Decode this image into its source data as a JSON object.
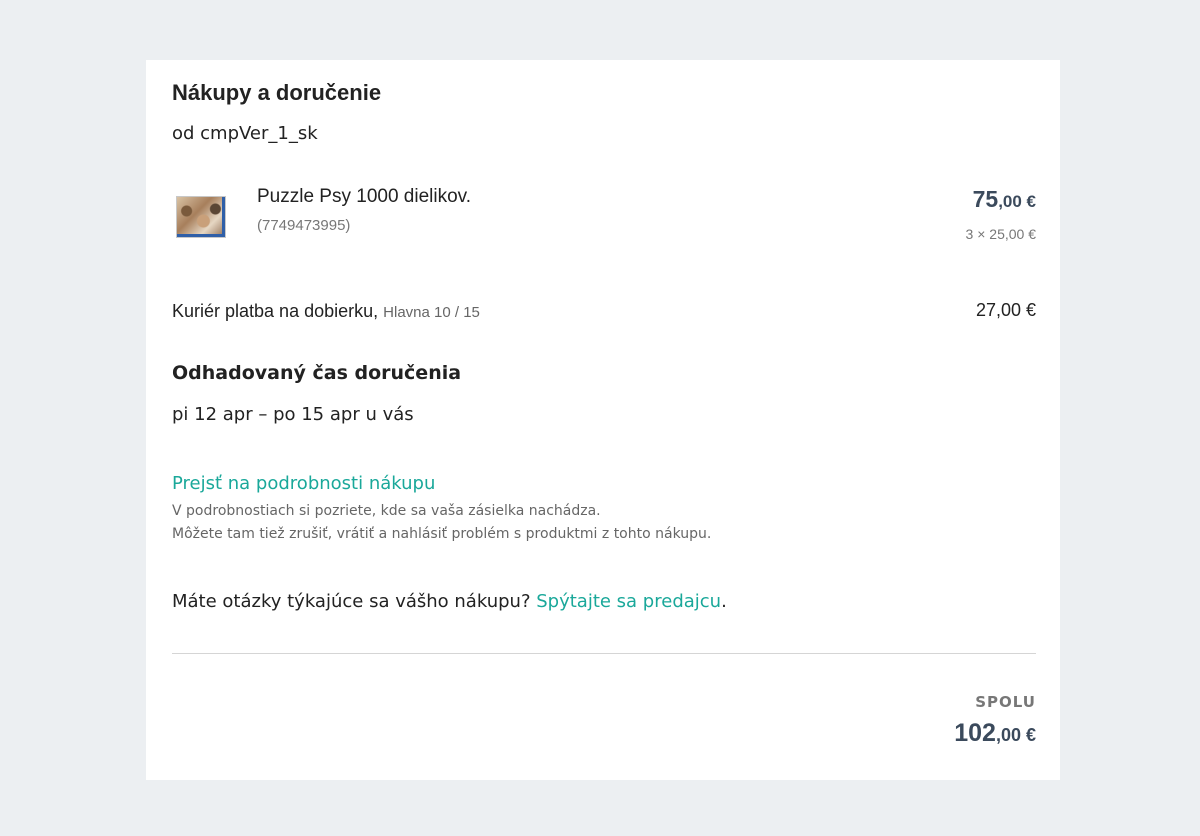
{
  "order": {
    "title": "Nákupy a doručenie",
    "seller": "od cmpVer_1_sk"
  },
  "item": {
    "image_icon": "puzzle-box-image",
    "name": "Puzzle Psy 1000 dielikov.",
    "id": "(7749473995)",
    "total_whole": "75",
    "total_cents": ",00 €",
    "unit_price": "3 × 25,00 €"
  },
  "shipping": {
    "method": "Kuriér platba na dobierku,",
    "address": "Hlavna 10 / 15",
    "price": "27,00 €"
  },
  "delivery": {
    "title": "Odhadovaný čas doručenia",
    "dates": "pi 12 apr – po 15 apr u vás"
  },
  "details": {
    "link": "Prejsť na podrobnosti nákupu",
    "line1": "V podrobnostiach si pozriete, kde sa vaša zásielka nachádza.",
    "line2": "Môžete tam tiež zrušiť, vrátiť a nahlásiť problém s produktmi z tohto nákupu."
  },
  "question": {
    "text": "Máte otázky týkajúce sa vášho nákupu? ",
    "link": "Spýtajte sa predajcu",
    "suffix": "."
  },
  "total": {
    "label": "SPOLU",
    "whole": "102",
    "cents": ",00 €"
  },
  "colors": {
    "accent": "#1aa89a",
    "price": "#3b4a5c",
    "background": "#eceff2"
  }
}
